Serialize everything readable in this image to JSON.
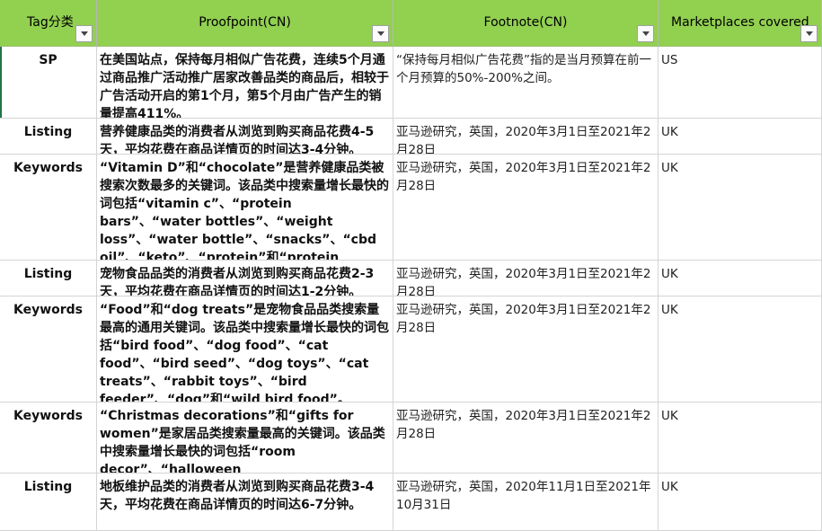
{
  "header": {
    "columns": [
      {
        "label": "Tag分类"
      },
      {
        "label": "Proofpoint(CN)"
      },
      {
        "label": "Footnote(CN)"
      },
      {
        "label": "Marketplaces covered"
      }
    ]
  },
  "rows": [
    {
      "tag": "SP",
      "proofpoint": "在美国站点，保持每月相似广告花费，连续5个月通过商品推广活动推广居家改善品类的商品后，相较于广告活动开启的第1个月，第5个月由广告产生的销量提高411%。",
      "footnote": "“保持每月相似广告花费”指的是当月预算在前一个月预算的50%-200%之间。",
      "marketplace": "US"
    },
    {
      "tag": "Listing",
      "proofpoint": "营养健康品类的消费者从浏览到购买商品花费4-5天，平均花费在商品详情页的时间达3-4分钟。",
      "footnote": "亚马逊研究，英国，2020年3月1日至2021年2月28日",
      "marketplace": "UK"
    },
    {
      "tag": "Keywords",
      "proofpoint": "“Vitamin D”和“chocolate”是营养健康品类被搜索次数最多的关键词。该品类中搜索量增长最快的词包括“vitamin c”、“protein bars”、“water bottles”、“weight loss”、“water bottle”、“snacks”、“cbd oil”、“keto”、“protein”和“protein shaker”。",
      "footnote": "亚马逊研究，英国，2020年3月1日至2021年2月28日",
      "marketplace": "UK"
    },
    {
      "tag": "Listing",
      "proofpoint": "宠物食品品类的消费者从浏览到购买商品花费2-3天，平均花费在商品详情页的时间达1-2分钟。",
      "footnote": "亚马逊研究，英国，2020年3月1日至2021年2月28日",
      "marketplace": "UK"
    },
    {
      "tag": "Keywords",
      "proofpoint": "“Food”和“dog treats”是宠物食品品类搜索量最高的通用关键词。该品类中搜索量增长最快的词包括“bird food”、“dog food”、“cat food”、“bird seed”、“dog toys”、“cat treats”、“rabbit toys”、“bird feeder”、“dog”和“wild bird food”。",
      "footnote": "亚马逊研究，英国，2020年3月1日至2021年2月28日",
      "marketplace": "UK"
    },
    {
      "tag": "Keywords",
      "proofpoint": "“Christmas decorations”和“gifts for women”是家居品类搜索量最高的关键词。该品类中搜索量增长最快的词包括“room decor”、“halloween decorations”和“crystals”。",
      "footnote": "亚马逊研究，英国，2020年3月1日至2021年2月28日",
      "marketplace": "UK"
    },
    {
      "tag": "Listing",
      "proofpoint": "地板维护品类的消费者从浏览到购买商品花费3-4天，平均花费在商品详情页的时间达6-7分钟。",
      "footnote": "亚马逊研究，英国，2020年11月1日至2021年10月31日",
      "marketplace": "UK"
    }
  ]
}
